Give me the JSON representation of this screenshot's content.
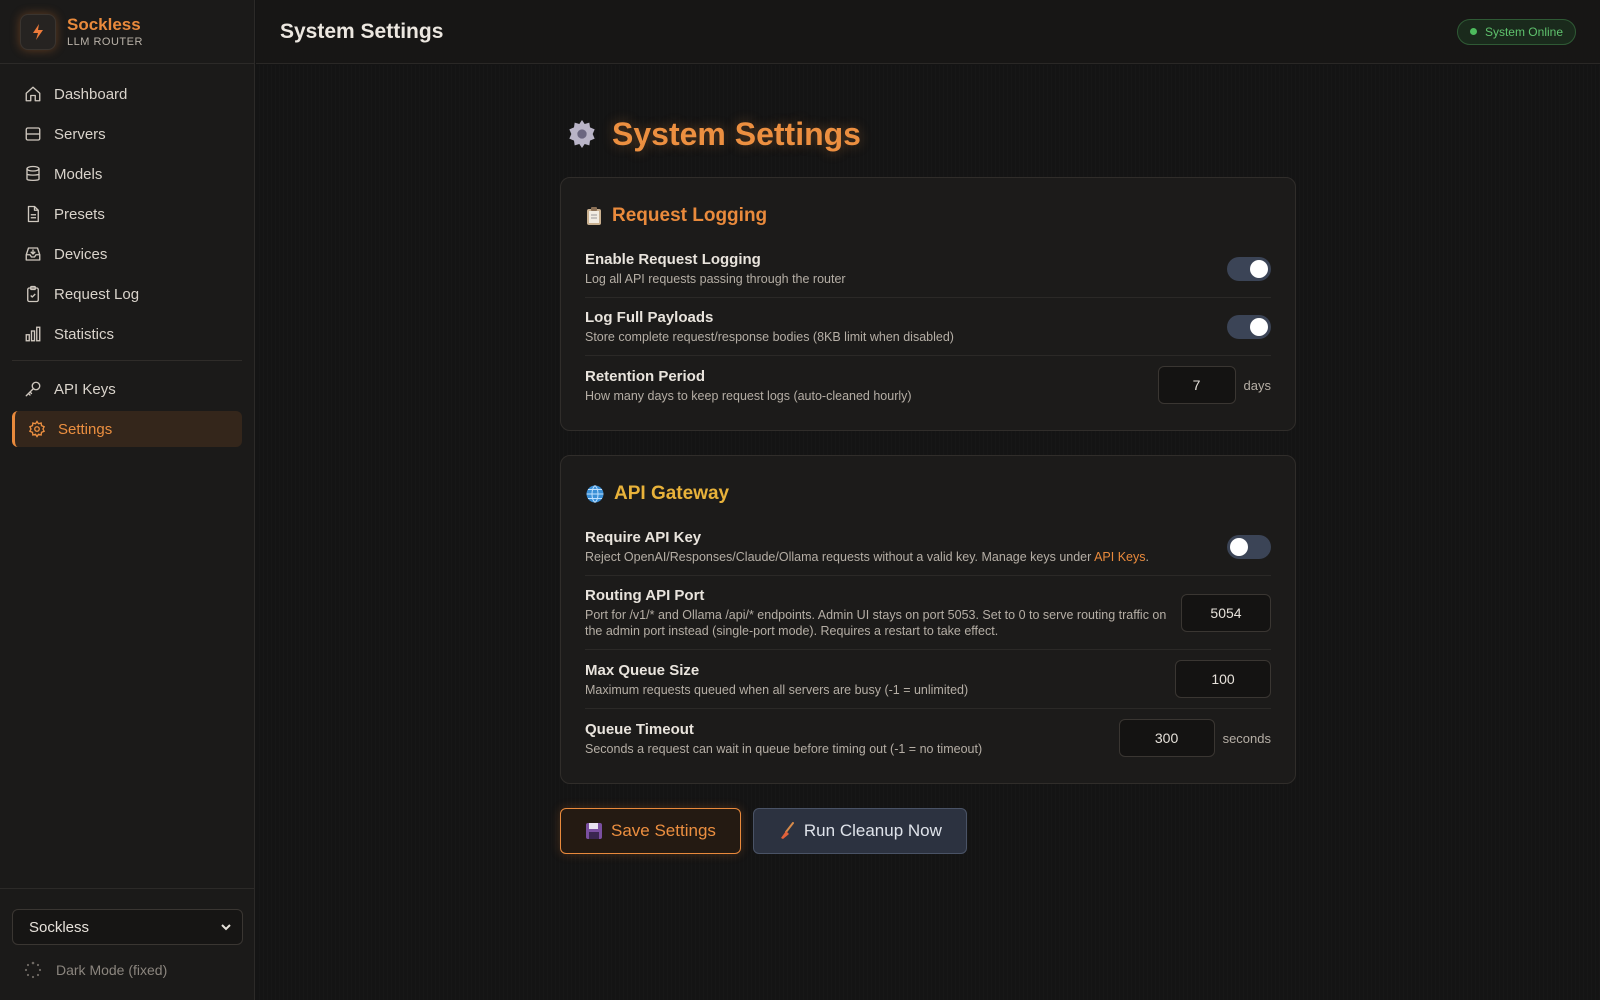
{
  "brand": {
    "name": "Sockless",
    "subtitle": "LLM ROUTER"
  },
  "sidebar": {
    "items": [
      {
        "label": "Dashboard",
        "icon": "home-icon"
      },
      {
        "label": "Servers",
        "icon": "server-icon"
      },
      {
        "label": "Models",
        "icon": "database-icon"
      },
      {
        "label": "Presets",
        "icon": "document-icon"
      },
      {
        "label": "Devices",
        "icon": "inbox-icon"
      },
      {
        "label": "Request Log",
        "icon": "clipboard-icon"
      },
      {
        "label": "Statistics",
        "icon": "bar-chart-icon"
      },
      {
        "label": "API Keys",
        "icon": "key-icon"
      },
      {
        "label": "Settings",
        "icon": "gear-icon",
        "active": true
      }
    ],
    "footer": {
      "selected_profile": "Sockless",
      "dark_mode_label": "Dark Mode (fixed)"
    }
  },
  "header": {
    "title": "System Settings",
    "status": "System Online"
  },
  "page": {
    "heading": "System Settings",
    "request_logging": {
      "title": "Request Logging",
      "enable": {
        "label": "Enable Request Logging",
        "desc": "Log all API requests passing through the router",
        "on": true
      },
      "full_payloads": {
        "label": "Log Full Payloads",
        "desc": "Store complete request/response bodies (8KB limit when disabled)",
        "on": true
      },
      "retention": {
        "label": "Retention Period",
        "desc": "How many days to keep request logs (auto-cleaned hourly)",
        "value": "7",
        "unit": "days"
      }
    },
    "api_gateway": {
      "title": "API Gateway",
      "require_key": {
        "label": "Require API Key",
        "desc": "Reject OpenAI/Responses/Claude/Ollama requests without a valid key. Manage keys under",
        "link": "API Keys",
        "desc_end": ".",
        "on": false
      },
      "routing_port": {
        "label": "Routing API Port",
        "desc": "Port for /v1/* and Ollama /api/* endpoints. Admin UI stays on port 5053. Set to 0 to serve routing traffic on the admin port instead (single-port mode). Requires a restart to take effect.",
        "value": "5054"
      },
      "max_queue": {
        "label": "Max Queue Size",
        "desc": "Maximum requests queued when all servers are busy (-1 = unlimited)",
        "value": "100"
      },
      "queue_timeout": {
        "label": "Queue Timeout",
        "desc": "Seconds a request can wait in queue before timing out (-1 = no timeout)",
        "value": "300",
        "unit": "seconds"
      }
    },
    "actions": {
      "save": "Save Settings",
      "cleanup": "Run Cleanup Now"
    }
  },
  "colors": {
    "accent": "#e98a3c",
    "gold": "#e8b23a",
    "online": "#5fc26d",
    "toggle": "#3b4456"
  }
}
